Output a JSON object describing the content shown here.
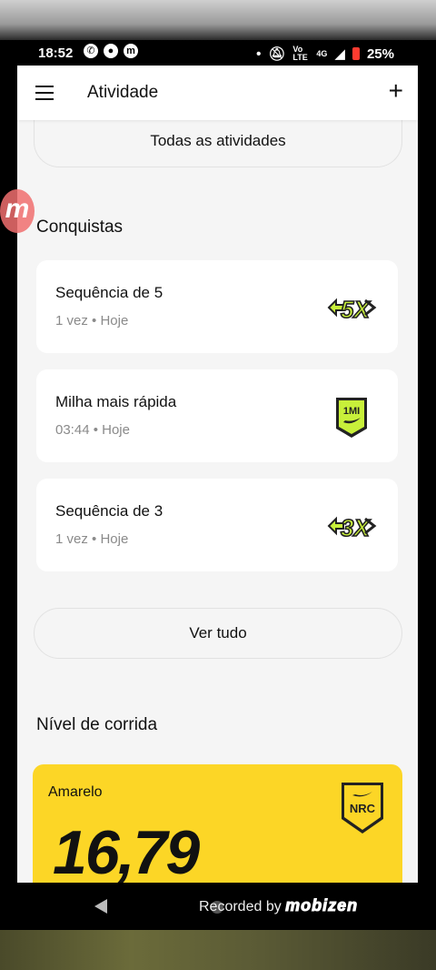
{
  "status_bar": {
    "time": "18:52",
    "network_lte": "Vo LTE",
    "network_4g": "4G",
    "battery": "25%"
  },
  "app_bar": {
    "title": "Atividade"
  },
  "buttons": {
    "all_activities": "Todas as atividades",
    "see_all": "Ver tudo"
  },
  "achievements": {
    "title": "Conquistas",
    "items": [
      {
        "title": "Sequência de 5",
        "subtitle": "1 vez • Hoje",
        "badge": "5X"
      },
      {
        "title": "Milha mais rápida",
        "subtitle": "03:44 • Hoje",
        "badge": "1MI"
      },
      {
        "title": "Sequência de 3",
        "subtitle": "1 vez • Hoje",
        "badge": "3X"
      }
    ]
  },
  "running_level": {
    "title": "Nível de corrida",
    "level_name": "Amarelo",
    "value": "16,79",
    "badge": "NRC"
  },
  "recorder": {
    "text": "Recorded by",
    "brand": "mobizen"
  },
  "colors": {
    "accent_yellow": "#fcd626",
    "badge_green": "#c8f03a",
    "background": "#f5f5f5"
  }
}
